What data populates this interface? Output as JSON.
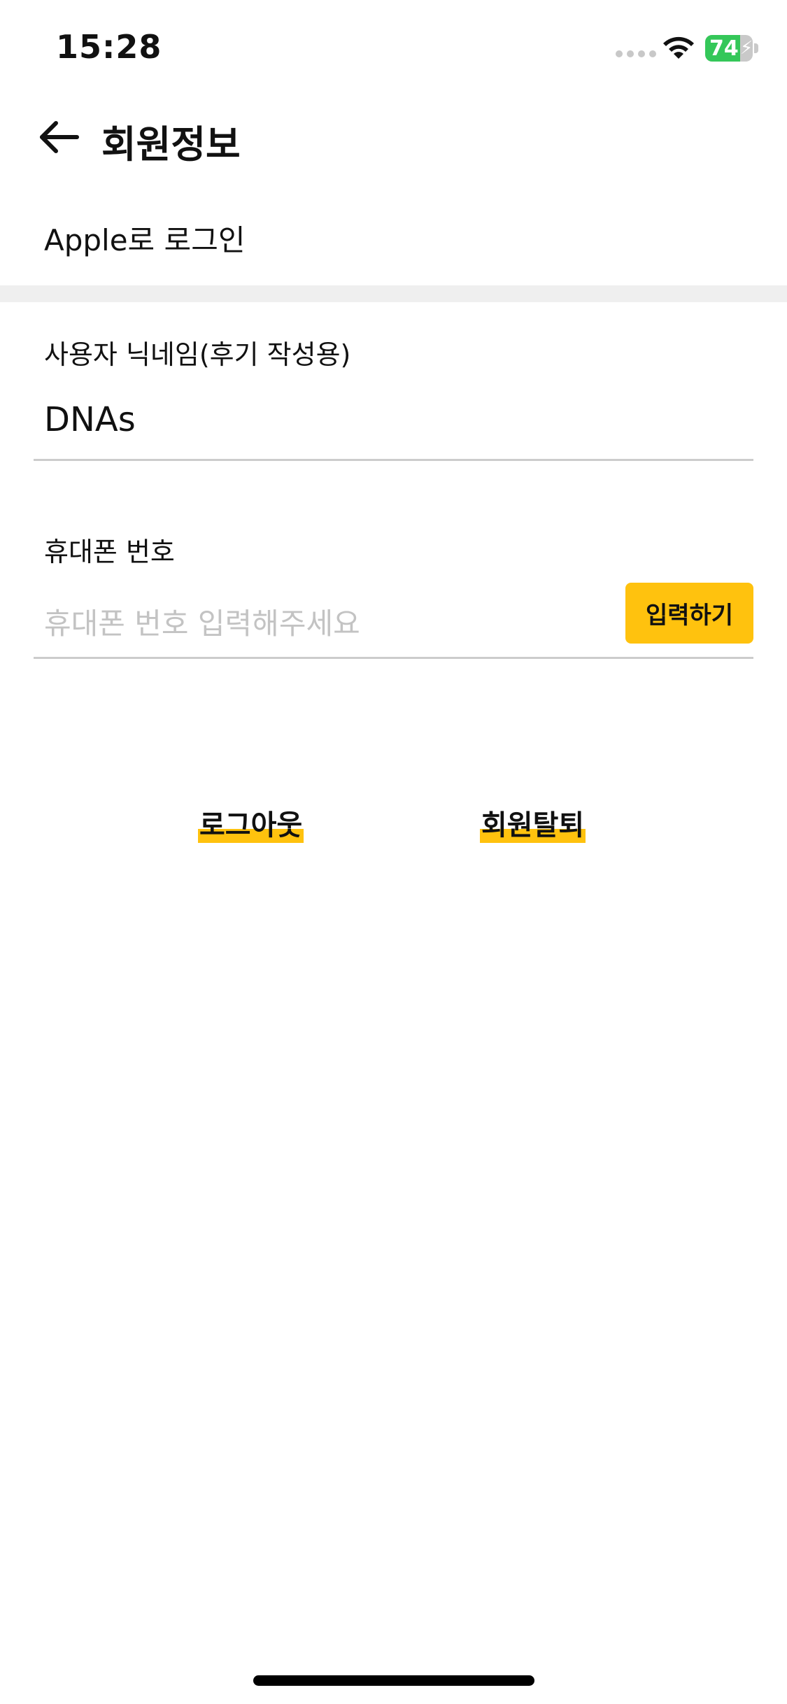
{
  "status_bar": {
    "time": "15:28",
    "battery_level": "74",
    "battery_percent": 74,
    "battery_color": "#34c759",
    "icons": [
      "cellular-signal-icon",
      "wifi-icon",
      "battery-icon",
      "charging-bolt-icon"
    ]
  },
  "header": {
    "back_icon": "arrow-left-icon",
    "title": "회원정보"
  },
  "login_method": "Apple로 로그인",
  "nickname": {
    "label": "사용자 닉네임(후기 작성용)",
    "value": "DNAs"
  },
  "phone": {
    "label": "휴대폰 번호",
    "placeholder": "휴대폰 번호 입력해주세요",
    "button_label": "입력하기"
  },
  "actions": {
    "logout": "로그아웃",
    "withdraw": "회원탈퇴"
  },
  "colors": {
    "accent": "#ffc20e",
    "divider": "#efefef",
    "underline": "#cccccc",
    "placeholder": "#c3c3c3"
  }
}
